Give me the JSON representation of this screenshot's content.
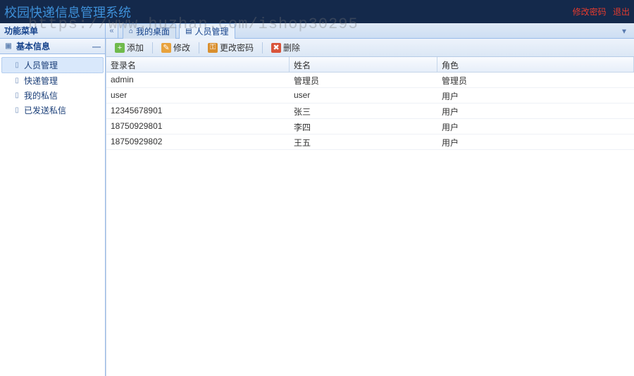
{
  "app_title": "校园快递信息管理系统",
  "watermark": "https://www.huzhan.com/ishop30295",
  "header_links": {
    "change_pwd": "修改密码",
    "logout": "退出"
  },
  "sidebar_title": "功能菜单",
  "accordion": {
    "title": "基本信息",
    "items": [
      {
        "label": "人员管理",
        "selected": true
      },
      {
        "label": "快递管理",
        "selected": false
      },
      {
        "label": "我的私信",
        "selected": false
      },
      {
        "label": "已发送私信",
        "selected": false
      }
    ]
  },
  "tabs": [
    {
      "label": "我的桌面",
      "icon": "home",
      "active": false
    },
    {
      "label": "人员管理",
      "icon": "doc",
      "active": true
    }
  ],
  "toolbar": {
    "add": "添加",
    "edit": "修改",
    "change_pwd": "更改密码",
    "delete": "删除"
  },
  "grid": {
    "columns": {
      "login": "登录名",
      "name": "姓名",
      "role": "角色"
    },
    "rows": [
      {
        "login": "admin",
        "name": "管理员",
        "role": "管理员"
      },
      {
        "login": "user",
        "name": "user",
        "role": "用户"
      },
      {
        "login": "12345678901",
        "name": "张三",
        "role": "用户"
      },
      {
        "login": "18750929801",
        "name": "李四",
        "role": "用户"
      },
      {
        "login": "18750929802",
        "name": "王五",
        "role": "用户"
      }
    ]
  }
}
